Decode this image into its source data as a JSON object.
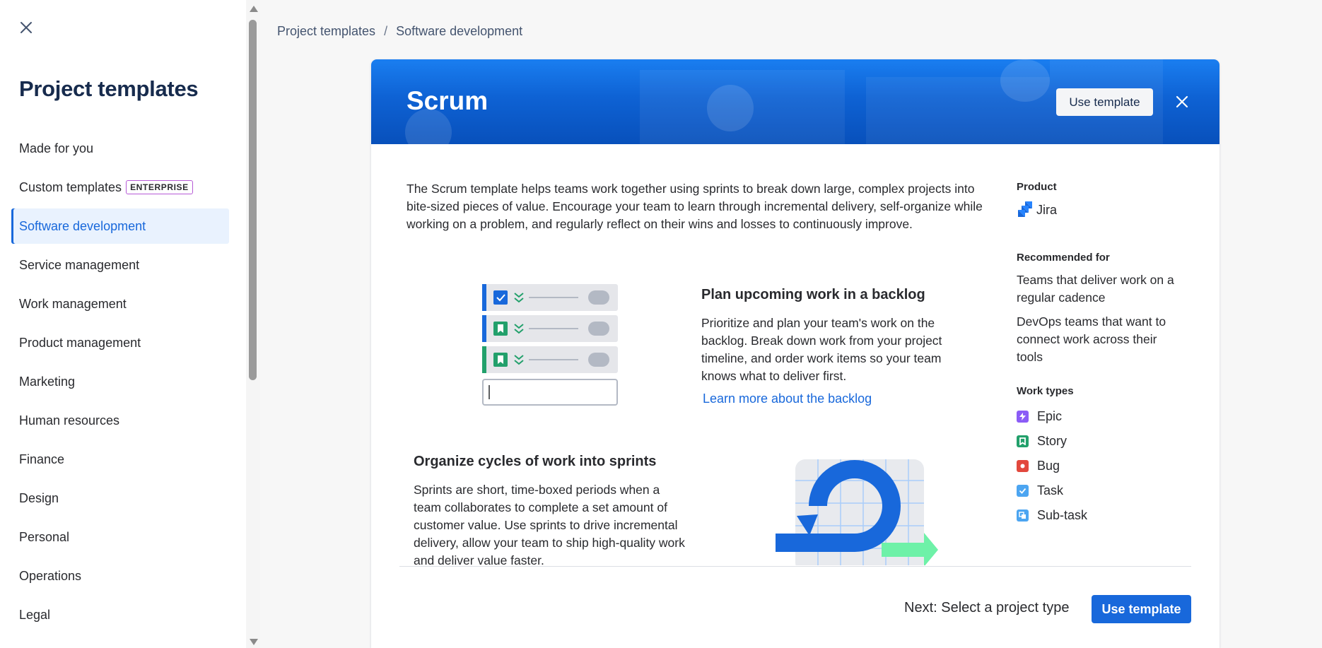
{
  "sidebar": {
    "title": "Project templates",
    "items": [
      {
        "label": "Made for you"
      },
      {
        "label": "Custom templates",
        "badge": "ENTERPRISE"
      },
      {
        "label": "Software development",
        "active": true
      },
      {
        "label": "Service management"
      },
      {
        "label": "Work management"
      },
      {
        "label": "Product management"
      },
      {
        "label": "Marketing"
      },
      {
        "label": "Human resources"
      },
      {
        "label": "Finance"
      },
      {
        "label": "Design"
      },
      {
        "label": "Personal"
      },
      {
        "label": "Operations"
      },
      {
        "label": "Legal"
      }
    ]
  },
  "breadcrumb": {
    "root": "Project templates",
    "separator": "/",
    "current": "Software development"
  },
  "template": {
    "title": "Scrum",
    "use_template_label": "Use template",
    "description": "The Scrum template helps teams work together using sprints to break down large, complex projects into bite-sized pieces of value. Encourage your team to learn through incremental delivery, self-organize while working on a problem, and regularly reflect on their wins and losses to continuously improve.",
    "feature1": {
      "title": "Plan upcoming work in a backlog",
      "body": "Prioritize and plan your team's work on the backlog. Break down work from your project timeline, and order work items so your team knows what to deliver first.",
      "link": "Learn more about the backlog"
    },
    "feature2": {
      "title": "Organize cycles of work into sprints",
      "body": "Sprints are short, time-boxed periods when a team collaborates to complete a set amount of customer value. Use sprints to drive incremental delivery, allow your team to ship high-quality work and deliver value faster."
    }
  },
  "details": {
    "product_heading": "Product",
    "product": "Jira",
    "recommended_heading": "Recommended for",
    "recommended": [
      "Teams that deliver work on a regular cadence",
      "DevOps teams that want to connect work across their tools"
    ],
    "worktypes_heading": "Work types",
    "worktypes": [
      {
        "label": "Epic",
        "color": "#8b5cf6",
        "icon": "lightning-icon"
      },
      {
        "label": "Story",
        "color": "#22a06b",
        "icon": "bookmark-icon"
      },
      {
        "label": "Bug",
        "color": "#e2483d",
        "icon": "bug-icon"
      },
      {
        "label": "Task",
        "color": "#4ca5f1",
        "icon": "check-icon"
      },
      {
        "label": "Sub-task",
        "color": "#4ca5f1",
        "icon": "subtask-icon"
      }
    ]
  },
  "footer": {
    "next_label": "Next: Select a project type",
    "use_template_label": "Use template"
  },
  "colors": {
    "accent": "#1868db",
    "hero": "#0e62d4",
    "enterprise_badge": "#b65ad6"
  }
}
